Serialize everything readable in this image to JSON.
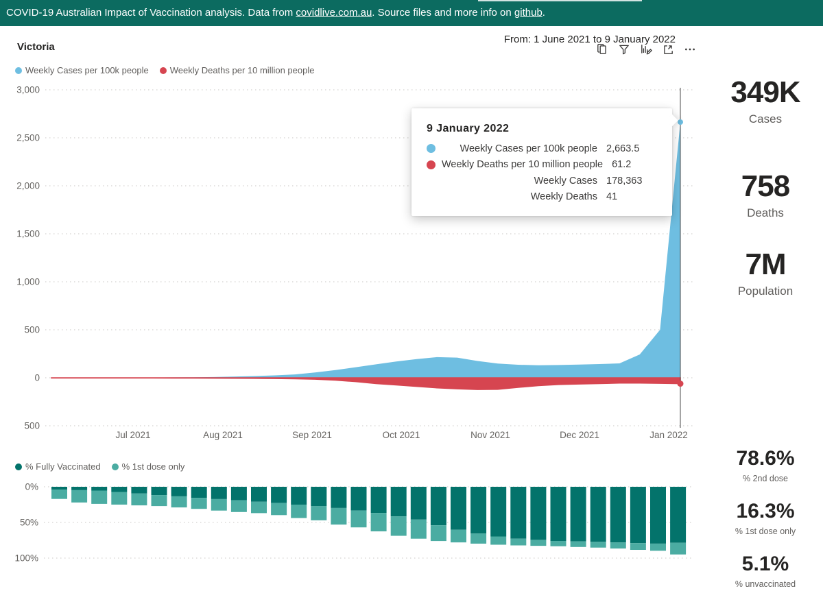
{
  "header": {
    "text_before": "COVID-19 Australian Impact of Vaccination analysis. Data from ",
    "link_covidlive": "covidlive.com.au",
    "text_middle": ". Source files and more info on ",
    "link_github": "github",
    "text_after": "."
  },
  "region_title": "Victoria",
  "toolbar": {
    "date_range": "From: 1 June 2021 to 9 January 2022",
    "icons": [
      "copy-visual",
      "filters",
      "personalize-visual",
      "focus-mode",
      "more-options"
    ]
  },
  "tooltip": {
    "title": "9 January 2022",
    "rows": [
      {
        "label": "Weekly Cases per 100k people",
        "value": "2,663.5",
        "dot_color": "#6EBEE1"
      },
      {
        "label": "Weekly Deaths per 10 million people",
        "value": "61.2",
        "dot_color": "#D64550"
      },
      {
        "label": "Weekly Cases",
        "value": "178,363",
        "dot_color": ""
      },
      {
        "label": "Weekly Deaths",
        "value": "41",
        "dot_color": ""
      }
    ]
  },
  "kpis_top": [
    {
      "value": "349K",
      "label": "Cases"
    },
    {
      "value": "758",
      "label": "Deaths"
    },
    {
      "value": "7M",
      "label": "Population"
    }
  ],
  "kpis_bottom": [
    {
      "value": "78.6%",
      "label": "% 2nd dose"
    },
    {
      "value": "16.3%",
      "label": "% 1st dose only"
    },
    {
      "value": "5.1%",
      "label": "% unvaccinated"
    }
  ],
  "colors": {
    "header_teal": "#0C6B60",
    "cases_blue": "#6EBEE1",
    "deaths_red": "#D64550",
    "fully_vaccinated_teal": "#03736B",
    "first_dose_teal": "#4BACA2",
    "axis_gray": "#666461"
  },
  "chart_data": [
    {
      "type": "area",
      "title": "Weekly cases and deaths, Victoria",
      "x": [
        "6 Jun 2021",
        "13 Jun 2021",
        "20 Jun 2021",
        "27 Jun 2021",
        "4 Jul 2021",
        "11 Jul 2021",
        "18 Jul 2021",
        "25 Jul 2021",
        "1 Aug 2021",
        "8 Aug 2021",
        "15 Aug 2021",
        "22 Aug 2021",
        "29 Aug 2021",
        "5 Sep 2021",
        "12 Sep 2021",
        "19 Sep 2021",
        "26 Sep 2021",
        "3 Oct 2021",
        "10 Oct 2021",
        "17 Oct 2021",
        "24 Oct 2021",
        "31 Oct 2021",
        "7 Nov 2021",
        "14 Nov 2021",
        "21 Nov 2021",
        "28 Nov 2021",
        "5 Dec 2021",
        "12 Dec 2021",
        "19 Dec 2021",
        "26 Dec 2021",
        "2 Jan 2022",
        "9 Jan 2022"
      ],
      "series": [
        {
          "name": "Weekly Cases per 100k people",
          "color": "#6EBEE1",
          "axis_side": "above-zero",
          "values": [
            2,
            2,
            2,
            2,
            2,
            3,
            4,
            5,
            8,
            12,
            18,
            25,
            35,
            55,
            80,
            110,
            140,
            170,
            195,
            215,
            210,
            175,
            148,
            136,
            130,
            133,
            138,
            143,
            150,
            243,
            500,
            2663.5
          ]
        },
        {
          "name": "Weekly Deaths per 10 million people",
          "color": "#D64550",
          "axis_side": "below-zero",
          "values": [
            2,
            2,
            2,
            2,
            2,
            2,
            3,
            3,
            4,
            5,
            6,
            8,
            10,
            15,
            25,
            40,
            60,
            75,
            90,
            105,
            115,
            122,
            120,
            100,
            82,
            70,
            65,
            60,
            55,
            55,
            58,
            61.2
          ]
        }
      ],
      "y_ticks": [
        {
          "value": 3000,
          "label": "3,000"
        },
        {
          "value": 2500,
          "label": "2,500"
        },
        {
          "value": 2000,
          "label": "2,000"
        },
        {
          "value": 1500,
          "label": "1,500"
        },
        {
          "value": 1000,
          "label": "1,000"
        },
        {
          "value": 500,
          "label": "500"
        },
        {
          "value": 0,
          "label": "0"
        },
        {
          "value": -500,
          "label": "500"
        }
      ],
      "x_tick_labels": [
        "Jul 2021",
        "Aug 2021",
        "Sep 2021",
        "Oct 2021",
        "Nov 2021",
        "Dec 2021",
        "Jan 2022"
      ],
      "ylim": [
        -500,
        3000
      ],
      "grid": "dotted",
      "legend_position": "top-left",
      "selected_point": {
        "date": "9 January 2022",
        "cases_per_100k": 2663.5,
        "deaths_per_10m": 61.2,
        "weekly_cases": 178363,
        "weekly_deaths": 41
      }
    },
    {
      "type": "bar",
      "stacked": true,
      "orientation": "top-down",
      "title": "Weekly vaccination status, Victoria",
      "x": [
        "6 Jun 2021",
        "13 Jun 2021",
        "20 Jun 2021",
        "27 Jun 2021",
        "4 Jul 2021",
        "11 Jul 2021",
        "18 Jul 2021",
        "25 Jul 2021",
        "1 Aug 2021",
        "8 Aug 2021",
        "15 Aug 2021",
        "22 Aug 2021",
        "29 Aug 2021",
        "5 Sep 2021",
        "12 Sep 2021",
        "19 Sep 2021",
        "26 Sep 2021",
        "3 Oct 2021",
        "10 Oct 2021",
        "17 Oct 2021",
        "24 Oct 2021",
        "31 Oct 2021",
        "7 Nov 2021",
        "14 Nov 2021",
        "21 Nov 2021",
        "28 Nov 2021",
        "5 Dec 2021",
        "12 Dec 2021",
        "19 Dec 2021",
        "26 Dec 2021",
        "2 Jan 2022",
        "9 Jan 2022"
      ],
      "series": [
        {
          "name": "% Fully Vaccinated",
          "color": "#03736B",
          "values": [
            4,
            4.7,
            5.3,
            7.2,
            9.4,
            11.6,
            13.4,
            15.6,
            17.2,
            18.8,
            21,
            22.8,
            25,
            27.2,
            29.7,
            33.4,
            36.6,
            41.5,
            46,
            54,
            60.3,
            65.6,
            69.7,
            72.8,
            74.4,
            76,
            76.6,
            77.2,
            78.1,
            79,
            79.7,
            78.6
          ]
        },
        {
          "name": "% 1st dose only",
          "color": "#4BACA2",
          "values": [
            13,
            17.3,
            18.7,
            17.8,
            16.6,
            15.4,
            15.6,
            15.4,
            16.2,
            16.5,
            16,
            16.9,
            18.8,
            19.8,
            23.3,
            23.6,
            25.9,
            27.2,
            26.8,
            22,
            17.7,
            14.1,
            11.5,
            9.4,
            8.4,
            7.4,
            7.8,
            8.1,
            8.5,
            9.4,
            10,
            16.3
          ]
        }
      ],
      "y_tick_labels": [
        "0%",
        "50%",
        "100%"
      ],
      "ylim": [
        0,
        100
      ],
      "grid": "dotted",
      "legend_position": "top-left"
    }
  ]
}
